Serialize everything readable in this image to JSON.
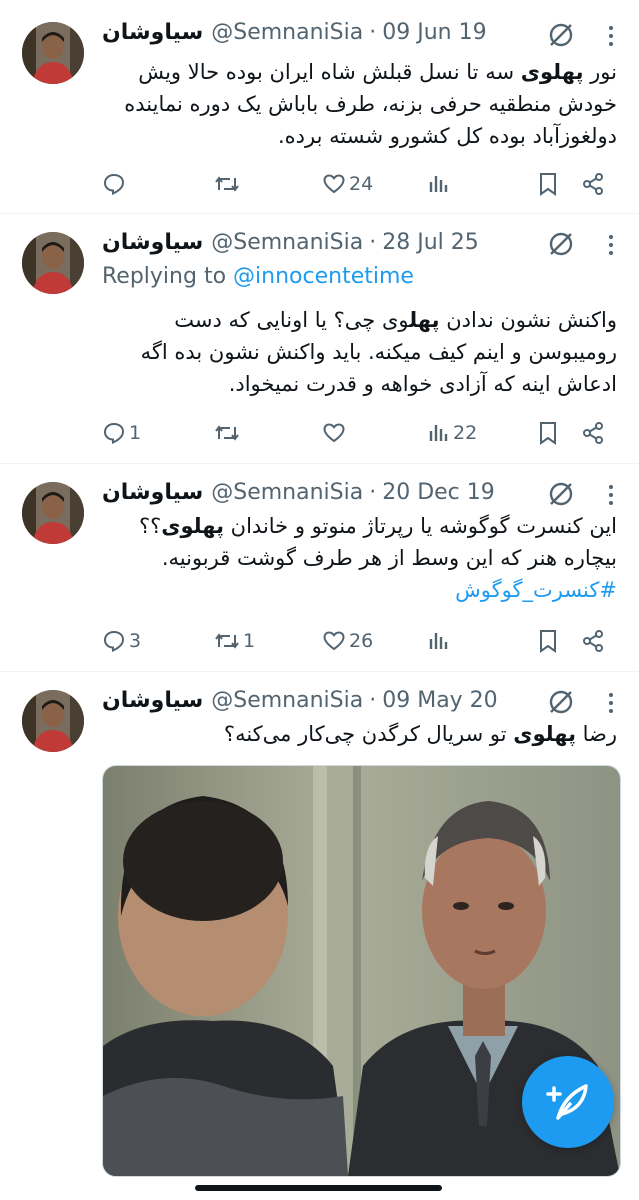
{
  "colors": {
    "accent": "#1d9bf0",
    "text": "#0f1419",
    "muted": "#536471",
    "divider": "#eff3f4"
  },
  "tweets": [
    {
      "name": "سیاوشان",
      "handle": "@SemnaniSia",
      "separator": "·",
      "date": "09 Jun 19",
      "text_bold": "پهلوی",
      "text_pre": "نور ",
      "text_post": " سه تا نسل قبلش شاه ایران بوده حالا ویش خودش منطقیه حرفی بزنه، طرف باباش یک دوره نماینده دولغوزآباد بوده کل کشورو شسته برده.",
      "replies": "",
      "retweets": "",
      "likes": "24",
      "views": ""
    },
    {
      "name": "سیاوشان",
      "handle": "@SemnaniSia",
      "separator": "·",
      "date": "28 Jul 25",
      "replying_label": "Replying to ",
      "replying_handle": "@innocentetime",
      "text_pre": "واکنش نشون ندادن ",
      "text_bold": "پهل",
      "text_post": "وی چی؟ یا اونایی که دست رومیبوسن و اینم کیف میکنه. باید واکنش نشون بده اگه ادعاش اینه که آزادی خواهه و قدرت نمیخواد.",
      "replies": "1",
      "retweets": "",
      "likes": "",
      "views": "22"
    },
    {
      "name": "سیاوشان",
      "handle": "@SemnaniSia",
      "separator": "·",
      "date": "20 Dec 19",
      "text_pre": "این کنسرت گوگوشه یا رپرتاژ منوتو و خاندان ",
      "text_bold": "پهلوی",
      "text_post": "؟؟ بیچاره هنر که این وسط از هر طرف گوشت قربونیه.",
      "hashtag": "#کنسرت_گوگوش",
      "replies": "3",
      "retweets": "1",
      "likes": "26",
      "views": ""
    },
    {
      "name": "سیاوشان",
      "handle": "@SemnaniSia",
      "separator": "·",
      "date": "09 May 20",
      "text_pre": "رضا ",
      "text_bold": "پهلوی",
      "text_post": " تو سریال کرگدن چی‌کار می‌کنه؟",
      "has_media": true
    }
  ],
  "icons": {
    "reply": "reply-icon",
    "retweet": "retweet-icon",
    "like": "like-icon",
    "views": "views-icon",
    "bookmark": "bookmark-icon",
    "share": "share-icon",
    "mute": "mute-icon",
    "more": "more-icon",
    "compose": "compose-icon"
  }
}
